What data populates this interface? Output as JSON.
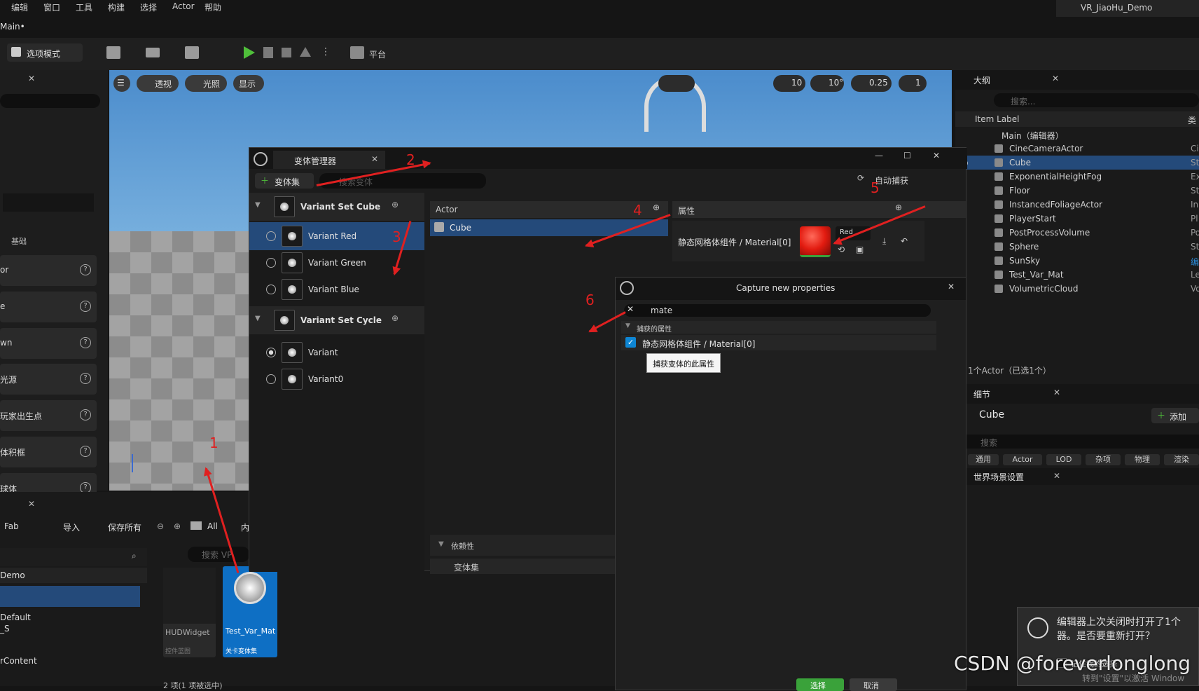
{
  "menu": [
    "编辑",
    "窗口",
    "工具",
    "构建",
    "选择",
    "Actor",
    "帮助"
  ],
  "project_name": "VR_JiaoHu_Demo",
  "level_tab": "Main•",
  "toolbar": {
    "mode": "选项模式",
    "platform": "平台"
  },
  "place": {
    "category_label": "基础",
    "items": [
      "or",
      "e",
      "wn",
      "光源",
      "玩家出生点",
      "体积框",
      "球体"
    ]
  },
  "viewport": {
    "perspective": "透视",
    "lit": "光照",
    "show": "显示",
    "grid": "10",
    "angle": "10°",
    "scale": "0.25",
    "camera": "1"
  },
  "vm": {
    "title": "变体管理器",
    "add_varset": "变体集",
    "search_placeholder": "搜索变体",
    "auto_capture": "自动捕获",
    "sets": [
      {
        "name": "Variant Set Cube",
        "variants": [
          "Variant Red",
          "Variant Green",
          "Variant Blue"
        ]
      },
      {
        "name": "Variant Set Cycle",
        "variants": [
          "Variant",
          "Variant0"
        ]
      }
    ],
    "actor_header": "Actor",
    "actor_item": "Cube",
    "props_header": "属性",
    "prop_name": "静态网格体组件 / Material[0]",
    "prop_value": "Red",
    "deps_header": "依赖性",
    "deps_col": "变体集"
  },
  "capture": {
    "title": "Capture new properties",
    "search": "mate",
    "group": "捕获的属性",
    "item": "静态网格体组件 / Material[0]",
    "tooltip": "捕获变体的此属性",
    "select": "选择",
    "cancel": "取消"
  },
  "outliner": {
    "title": "大纲",
    "search_placeholder": "搜索...",
    "col_label": "Item Label",
    "col_type": "类",
    "root": "Main（编辑器）",
    "items": [
      {
        "name": "CineCameraActor",
        "type": "Ci"
      },
      {
        "name": "Cube",
        "type": "St"
      },
      {
        "name": "ExponentialHeightFog",
        "type": "Ex"
      },
      {
        "name": "Floor",
        "type": "St"
      },
      {
        "name": "InstancedFoliageActor",
        "type": "In"
      },
      {
        "name": "PlayerStart",
        "type": "Pl"
      },
      {
        "name": "PostProcessVolume",
        "type": "Po"
      },
      {
        "name": "Sphere",
        "type": "St"
      },
      {
        "name": "SunSky",
        "type": "编"
      },
      {
        "name": "Test_Var_Mat",
        "type": "Le"
      },
      {
        "name": "VolumetricCloud",
        "type": "Vo"
      }
    ],
    "count": "1个Actor（已选1个）"
  },
  "details": {
    "title": "细节",
    "actor": "Cube",
    "add": "添加",
    "search_placeholder": "搜索",
    "tabs": [
      "通用",
      "Actor",
      "LOD",
      "杂项",
      "物理",
      "渲染"
    ],
    "world": "世界场景设置"
  },
  "cb": {
    "fab": "Fab",
    "import": "导入",
    "save_all": "保存所有",
    "all": "All",
    "inner": "内",
    "search_placeholder": "搜索 VP",
    "folder": "Demo",
    "tree": [
      "Default",
      "_S",
      "rContent"
    ],
    "assets": [
      {
        "name": "HUDWidget",
        "type": "控件蓝图"
      },
      {
        "name": "Test_Var_Mat",
        "type": "关卡变体集"
      }
    ],
    "status": "2 项(1 项被选中)"
  },
  "annotations": [
    "1",
    "2",
    "3",
    "4",
    "5",
    "6"
  ],
  "notification": {
    "line1": "编辑器上次关闭时打开了1个",
    "line2": "器。是否要重新打开？",
    "remember": "记住我的选择",
    "activate": "转到\"设置\"以激活 Window"
  },
  "watermark": "CSDN @foreverlonglong",
  "colors": {
    "accent": "#0e86d4",
    "selected": "#244a7a",
    "annotation": "#e02020",
    "play": "#4fbf3a"
  }
}
